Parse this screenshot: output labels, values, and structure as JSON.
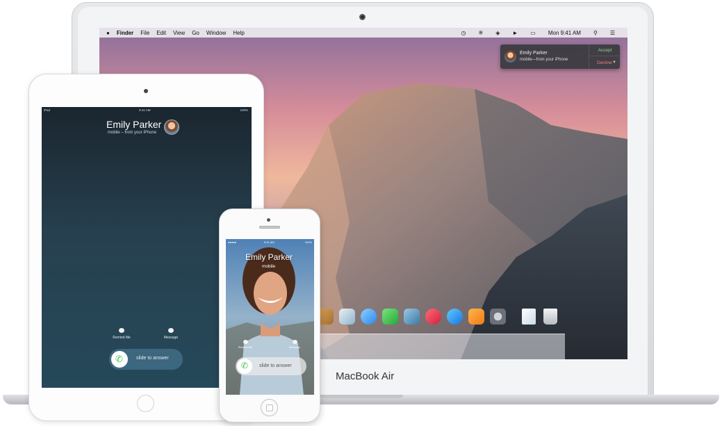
{
  "mac": {
    "menu": {
      "apple_icon": "apple-logo",
      "items": [
        "Finder",
        "File",
        "Edit",
        "View",
        "Go",
        "Window",
        "Help"
      ],
      "clock": "Mon 9:41 AM",
      "status_icons": [
        "time-machine-icon",
        "bluetooth-icon",
        "wifi-icon",
        "volume-icon",
        "battery-icon",
        "search-icon",
        "list-icon"
      ]
    },
    "notification": {
      "name": "Emily Parker",
      "subtitle": "mobile—from your iPhone",
      "accept": "Accept",
      "decline": "Decline"
    },
    "dock_icons": [
      "finder",
      "preview",
      "messages",
      "facetime",
      "photos",
      "music",
      "app-store",
      "ibooks",
      "system-preferences",
      "documents",
      "trash"
    ],
    "brand": "MacBook Air"
  },
  "ipad": {
    "status": {
      "left": "iPad",
      "time": "9:41 AM",
      "battery": "100%"
    },
    "caller": "Emily Parker",
    "subtitle": "mobile – from your iPhone",
    "actions": {
      "remind": "Remind Me",
      "message": "Message"
    },
    "slide": "slide to answer"
  },
  "iphone": {
    "status": {
      "left": "●●●●●",
      "time": "9:41 AM",
      "battery": "100%"
    },
    "caller": "Emily Parker",
    "subtitle": "mobile",
    "actions": {
      "remind": "Remind Me",
      "message": "Message"
    },
    "slide": "slide to answer"
  }
}
